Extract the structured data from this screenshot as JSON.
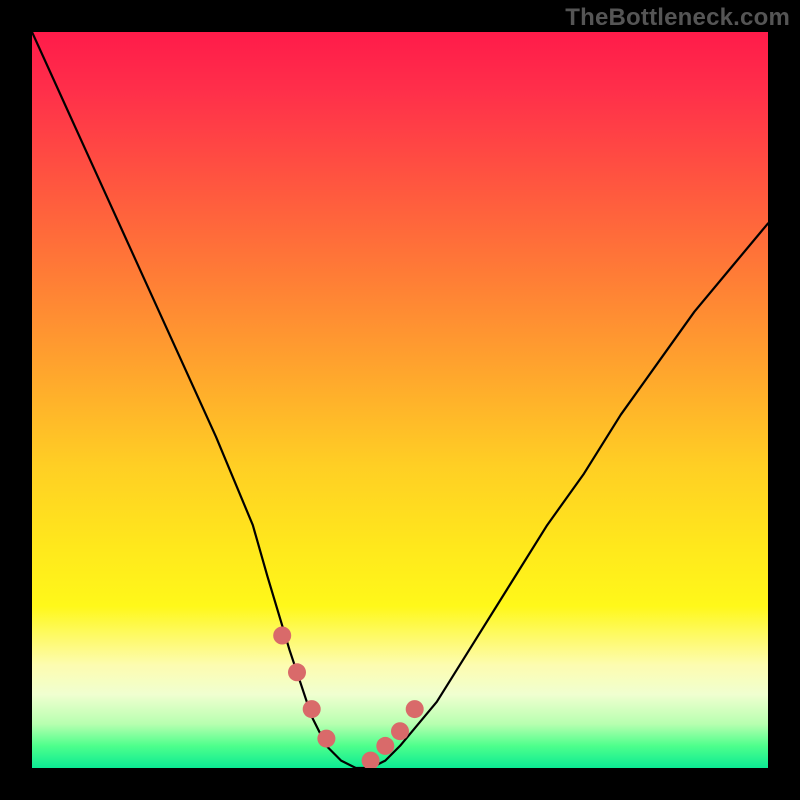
{
  "attribution": "TheBottleneck.com",
  "chart_data": {
    "type": "line",
    "title": "",
    "xlabel": "",
    "ylabel": "",
    "xlim": [
      0,
      100
    ],
    "ylim": [
      0,
      100
    ],
    "series": [
      {
        "name": "bottleneck-curve",
        "x": [
          0,
          5,
          10,
          15,
          20,
          25,
          30,
          32,
          35,
          38,
          40,
          42,
          44,
          46,
          48,
          50,
          55,
          60,
          65,
          70,
          75,
          80,
          85,
          90,
          95,
          100
        ],
        "values": [
          100,
          89,
          78,
          67,
          56,
          45,
          33,
          26,
          16,
          7,
          3,
          1,
          0,
          0,
          1,
          3,
          9,
          17,
          25,
          33,
          40,
          48,
          55,
          62,
          68,
          74
        ]
      }
    ],
    "markers": {
      "name": "highlighted-points",
      "x": [
        34,
        36,
        38,
        40,
        46,
        48,
        50,
        52
      ],
      "values": [
        18,
        13,
        8,
        4,
        1,
        3,
        5,
        8
      ]
    },
    "gradient_stops": [
      {
        "pos": 0.0,
        "color": "#ff1b4a"
      },
      {
        "pos": 0.33,
        "color": "#ff7c36"
      },
      {
        "pos": 0.7,
        "color": "#ffe81c"
      },
      {
        "pos": 0.9,
        "color": "#f0ffd0"
      },
      {
        "pos": 1.0,
        "color": "#0bea93"
      }
    ]
  }
}
